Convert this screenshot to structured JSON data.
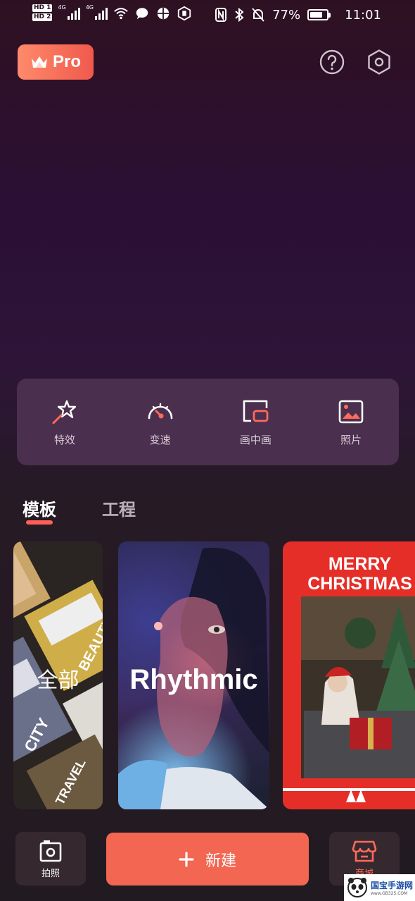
{
  "status_bar": {
    "hd1": "HD 1",
    "hd2": "HD 2",
    "net1": "4G",
    "net2": "4G",
    "battery_percent": "77%",
    "battery_level": 0.77,
    "time": "11:01"
  },
  "header": {
    "pro_label": "Pro",
    "help_icon": "question-circle-icon",
    "settings_icon": "hexagon-gear-icon"
  },
  "tools": [
    {
      "label": "特效",
      "icon": "magic-star-icon"
    },
    {
      "label": "变速",
      "icon": "speedometer-icon"
    },
    {
      "label": "画中画",
      "icon": "picture-in-picture-icon"
    },
    {
      "label": "照片",
      "icon": "photo-icon"
    }
  ],
  "tabs": {
    "active": "模板",
    "inactive": "工程"
  },
  "cards": [
    {
      "title": "全部"
    },
    {
      "title": "Rhythmic"
    },
    {
      "title": "MERRY CHRISTMAS"
    }
  ],
  "card_all_art": [
    "BEAUTY",
    "CITY",
    "TRAVEL"
  ],
  "bottom_bar": {
    "capture_label": "拍照",
    "new_label": "新建",
    "store_label": "商城"
  },
  "watermark": {
    "text": "国宝手游网",
    "url": "www.GB325.COM"
  },
  "colors": {
    "accent": "#f26652",
    "pro_gradient_start": "#ff8a6b",
    "pro_gradient_end": "#f0594c",
    "panel": "#4a2f4e"
  }
}
